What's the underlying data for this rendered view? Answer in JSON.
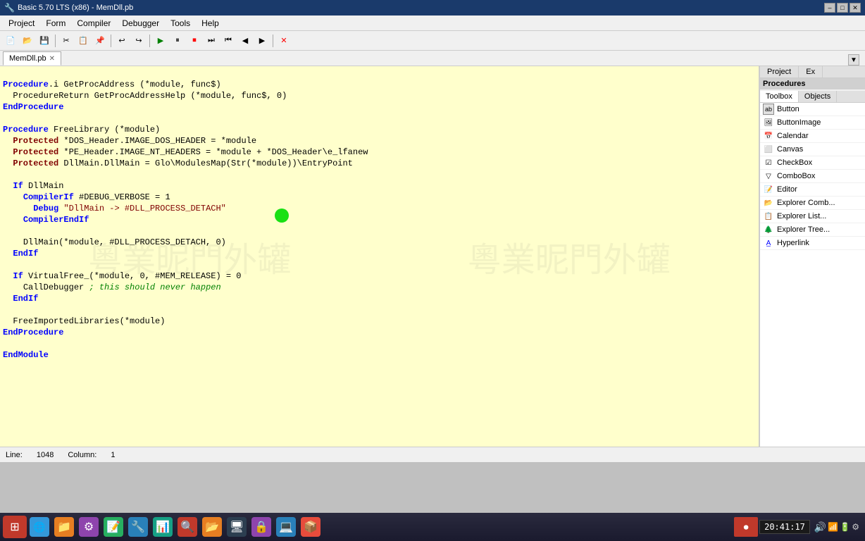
{
  "titlebar": {
    "title": "Basic 5.70 LTS (x86) - MemDll.pb",
    "minimize": "–",
    "maximize": "□",
    "close": "✕"
  },
  "menubar": {
    "items": [
      "Project",
      "Form",
      "Compiler",
      "Debugger",
      "Tools",
      "Help"
    ]
  },
  "toolbar": {
    "buttons": [
      "📁",
      "💾",
      "✂",
      "📋",
      "↩",
      "↪",
      "▶",
      "⏸",
      "⏹",
      "⏭",
      "◀",
      "◀◀",
      "▶▶",
      "✕"
    ]
  },
  "tabs": [
    {
      "label": "MemDll.pb",
      "active": true
    }
  ],
  "code": {
    "lines": [
      "Procedure.i GetProcAddress (*module, func$)",
      "  ProcedureReturn GetProcAddressHelp (*module, func$, 0)",
      "EndProcedure",
      "",
      "Procedure FreeLibrary (*module)",
      "  Protected *DOS_Header.IMAGE_DOS_HEADER = *module",
      "  Protected *PE_Header.IMAGE_NT_HEADERS = *module + *DOS_Header\\e_lfanew",
      "  Protected DllMain.DllMain = Glo\\ModulesMap(Str(*module))\\EntryPoint",
      "",
      "  If DllMain",
      "    CompilerIf #DEBUG_VERBOSE = 1",
      "      Debug \"DllMain -> #DLL_PROCESS_DETACH\"",
      "    CompilerEndIf",
      "",
      "    DllMain(*module, #DLL_PROCESS_DETACH, 0)",
      "  EndIf",
      "",
      "  If VirtualFree_(*module, 0, #MEM_RELEASE) = 0",
      "    CallDebugger ; this should never happen",
      "  EndIf",
      "",
      "  FreeImportedLibraries(*module)",
      "EndProcedure",
      "",
      "EndModule"
    ]
  },
  "right_panel": {
    "top_tabs": [
      {
        "label": "Project",
        "active": false
      },
      {
        "label": "Ex",
        "active": false
      }
    ],
    "proc_tab": {
      "label": "Procedures",
      "active": true
    },
    "toolbox_tabs": [
      {
        "label": "Toolbox",
        "active": true
      },
      {
        "label": "Objects",
        "active": false
      }
    ],
    "toolbox_items": [
      {
        "label": "Button",
        "icon": "ab"
      },
      {
        "label": "ButtonImage",
        "icon": "🖼"
      },
      {
        "label": "Calendar",
        "icon": "📅"
      },
      {
        "label": "Canvas",
        "icon": "⬜"
      },
      {
        "label": "CheckBox",
        "icon": "☑"
      },
      {
        "label": "ComboBox",
        "icon": "▽"
      },
      {
        "label": "Editor",
        "icon": "📝"
      },
      {
        "label": "Explorer Comb...",
        "icon": "📂"
      },
      {
        "label": "Explorer List...",
        "icon": "📋"
      },
      {
        "label": "Explorer Tree...",
        "icon": "🌲"
      },
      {
        "label": "Hyperlink",
        "icon": "🔗"
      }
    ]
  },
  "statusbar": {
    "line_label": "Line:",
    "line_value": "1048",
    "col_label": "Column:",
    "col_value": "1"
  },
  "taskbar": {
    "items": [
      {
        "icon": "⊞",
        "color": "#c0392b",
        "label": "start"
      },
      {
        "icon": "🌐",
        "color": "#2980b9",
        "label": "browser"
      },
      {
        "icon": "📁",
        "color": "#27ae60",
        "label": "files"
      },
      {
        "icon": "⚙",
        "color": "#8e44ad",
        "label": "settings"
      },
      {
        "icon": "📝",
        "color": "#e67e22",
        "label": "editor"
      },
      {
        "icon": "🔧",
        "color": "#16a085",
        "label": "tool1"
      },
      {
        "icon": "📊",
        "color": "#2980b9",
        "label": "tool2"
      },
      {
        "icon": "🔍",
        "color": "#c0392b",
        "label": "search"
      },
      {
        "icon": "📂",
        "color": "#e67e22",
        "label": "folder"
      },
      {
        "icon": "🖥",
        "color": "#27ae60",
        "label": "desktop"
      },
      {
        "icon": "🔒",
        "color": "#8e44ad",
        "label": "security"
      },
      {
        "icon": "💻",
        "color": "#2980b9",
        "label": "pc"
      },
      {
        "icon": "📦",
        "color": "#e67e22",
        "label": "packages"
      },
      {
        "icon": "⬛",
        "color": "#c0392b",
        "label": "record"
      }
    ],
    "clock": "20:41:17",
    "date": ""
  }
}
